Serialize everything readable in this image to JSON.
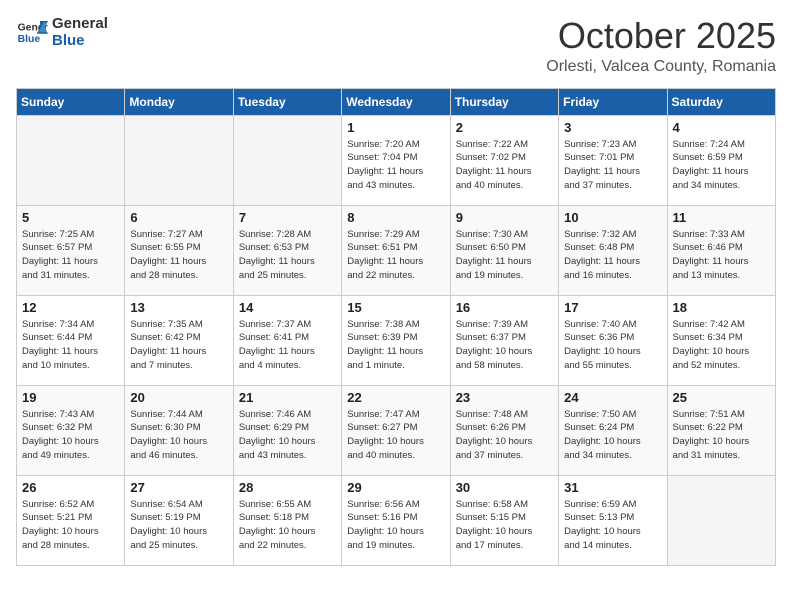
{
  "header": {
    "logo_general": "General",
    "logo_blue": "Blue",
    "title": "October 2025",
    "subtitle": "Orlesti, Valcea County, Romania"
  },
  "weekdays": [
    "Sunday",
    "Monday",
    "Tuesday",
    "Wednesday",
    "Thursday",
    "Friday",
    "Saturday"
  ],
  "weeks": [
    [
      {
        "day": "",
        "info": ""
      },
      {
        "day": "",
        "info": ""
      },
      {
        "day": "",
        "info": ""
      },
      {
        "day": "1",
        "info": "Sunrise: 7:20 AM\nSunset: 7:04 PM\nDaylight: 11 hours\nand 43 minutes."
      },
      {
        "day": "2",
        "info": "Sunrise: 7:22 AM\nSunset: 7:02 PM\nDaylight: 11 hours\nand 40 minutes."
      },
      {
        "day": "3",
        "info": "Sunrise: 7:23 AM\nSunset: 7:01 PM\nDaylight: 11 hours\nand 37 minutes."
      },
      {
        "day": "4",
        "info": "Sunrise: 7:24 AM\nSunset: 6:59 PM\nDaylight: 11 hours\nand 34 minutes."
      }
    ],
    [
      {
        "day": "5",
        "info": "Sunrise: 7:25 AM\nSunset: 6:57 PM\nDaylight: 11 hours\nand 31 minutes."
      },
      {
        "day": "6",
        "info": "Sunrise: 7:27 AM\nSunset: 6:55 PM\nDaylight: 11 hours\nand 28 minutes."
      },
      {
        "day": "7",
        "info": "Sunrise: 7:28 AM\nSunset: 6:53 PM\nDaylight: 11 hours\nand 25 minutes."
      },
      {
        "day": "8",
        "info": "Sunrise: 7:29 AM\nSunset: 6:51 PM\nDaylight: 11 hours\nand 22 minutes."
      },
      {
        "day": "9",
        "info": "Sunrise: 7:30 AM\nSunset: 6:50 PM\nDaylight: 11 hours\nand 19 minutes."
      },
      {
        "day": "10",
        "info": "Sunrise: 7:32 AM\nSunset: 6:48 PM\nDaylight: 11 hours\nand 16 minutes."
      },
      {
        "day": "11",
        "info": "Sunrise: 7:33 AM\nSunset: 6:46 PM\nDaylight: 11 hours\nand 13 minutes."
      }
    ],
    [
      {
        "day": "12",
        "info": "Sunrise: 7:34 AM\nSunset: 6:44 PM\nDaylight: 11 hours\nand 10 minutes."
      },
      {
        "day": "13",
        "info": "Sunrise: 7:35 AM\nSunset: 6:42 PM\nDaylight: 11 hours\nand 7 minutes."
      },
      {
        "day": "14",
        "info": "Sunrise: 7:37 AM\nSunset: 6:41 PM\nDaylight: 11 hours\nand 4 minutes."
      },
      {
        "day": "15",
        "info": "Sunrise: 7:38 AM\nSunset: 6:39 PM\nDaylight: 11 hours\nand 1 minute."
      },
      {
        "day": "16",
        "info": "Sunrise: 7:39 AM\nSunset: 6:37 PM\nDaylight: 10 hours\nand 58 minutes."
      },
      {
        "day": "17",
        "info": "Sunrise: 7:40 AM\nSunset: 6:36 PM\nDaylight: 10 hours\nand 55 minutes."
      },
      {
        "day": "18",
        "info": "Sunrise: 7:42 AM\nSunset: 6:34 PM\nDaylight: 10 hours\nand 52 minutes."
      }
    ],
    [
      {
        "day": "19",
        "info": "Sunrise: 7:43 AM\nSunset: 6:32 PM\nDaylight: 10 hours\nand 49 minutes."
      },
      {
        "day": "20",
        "info": "Sunrise: 7:44 AM\nSunset: 6:30 PM\nDaylight: 10 hours\nand 46 minutes."
      },
      {
        "day": "21",
        "info": "Sunrise: 7:46 AM\nSunset: 6:29 PM\nDaylight: 10 hours\nand 43 minutes."
      },
      {
        "day": "22",
        "info": "Sunrise: 7:47 AM\nSunset: 6:27 PM\nDaylight: 10 hours\nand 40 minutes."
      },
      {
        "day": "23",
        "info": "Sunrise: 7:48 AM\nSunset: 6:26 PM\nDaylight: 10 hours\nand 37 minutes."
      },
      {
        "day": "24",
        "info": "Sunrise: 7:50 AM\nSunset: 6:24 PM\nDaylight: 10 hours\nand 34 minutes."
      },
      {
        "day": "25",
        "info": "Sunrise: 7:51 AM\nSunset: 6:22 PM\nDaylight: 10 hours\nand 31 minutes."
      }
    ],
    [
      {
        "day": "26",
        "info": "Sunrise: 6:52 AM\nSunset: 5:21 PM\nDaylight: 10 hours\nand 28 minutes."
      },
      {
        "day": "27",
        "info": "Sunrise: 6:54 AM\nSunset: 5:19 PM\nDaylight: 10 hours\nand 25 minutes."
      },
      {
        "day": "28",
        "info": "Sunrise: 6:55 AM\nSunset: 5:18 PM\nDaylight: 10 hours\nand 22 minutes."
      },
      {
        "day": "29",
        "info": "Sunrise: 6:56 AM\nSunset: 5:16 PM\nDaylight: 10 hours\nand 19 minutes."
      },
      {
        "day": "30",
        "info": "Sunrise: 6:58 AM\nSunset: 5:15 PM\nDaylight: 10 hours\nand 17 minutes."
      },
      {
        "day": "31",
        "info": "Sunrise: 6:59 AM\nSunset: 5:13 PM\nDaylight: 10 hours\nand 14 minutes."
      },
      {
        "day": "",
        "info": ""
      }
    ]
  ]
}
